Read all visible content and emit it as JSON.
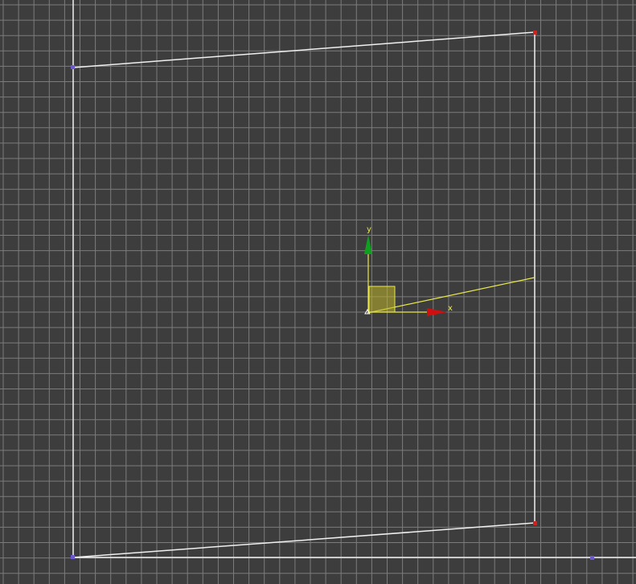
{
  "viewport": {
    "background": "#3d3d3d",
    "grid_color": "#7c7c7c",
    "shape_color": "#ffffff",
    "selection_color": "#e8e84a"
  },
  "gizmo": {
    "x_label": "x",
    "y_label": "y",
    "x_color": "#d01010",
    "y_color": "#10a020"
  }
}
